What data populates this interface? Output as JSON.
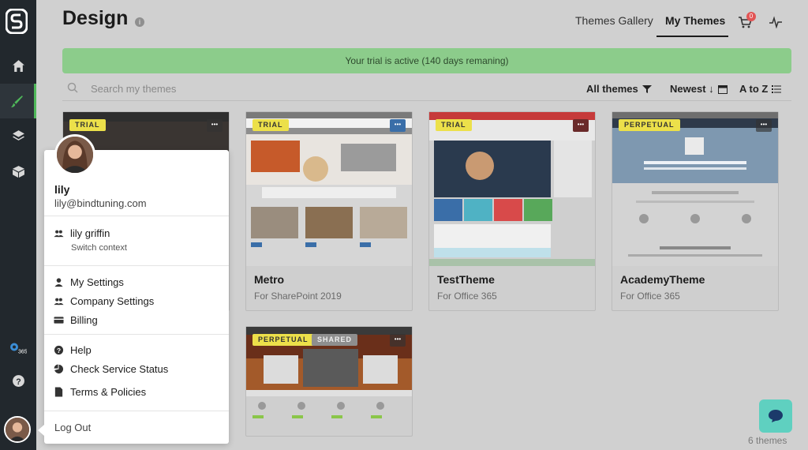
{
  "page": {
    "title": "Design",
    "info_glyph": "i"
  },
  "header": {
    "tabs": [
      {
        "label": "Themes Gallery",
        "active": false
      },
      {
        "label": "My Themes",
        "active": true
      }
    ],
    "cart_count": "0",
    "icons": [
      "cart-icon",
      "activity-icon"
    ]
  },
  "banner": {
    "text": "Your trial is active (140 days remaning)",
    "color": "#8ccc8b"
  },
  "search": {
    "placeholder": "Search my themes",
    "value": ""
  },
  "filters": {
    "all_themes": "All themes",
    "sort": "Newest ↓",
    "az": "A to Z"
  },
  "themes": [
    {
      "name": "",
      "subtitle": "",
      "badges": [
        "TRIAL"
      ]
    },
    {
      "name": "Metro",
      "subtitle": "For SharePoint 2019",
      "badges": [
        "TRIAL"
      ]
    },
    {
      "name": "TestTheme",
      "subtitle": "For Office 365",
      "badges": [
        "TRIAL"
      ]
    },
    {
      "name": "AcademyTheme",
      "subtitle": "For Office 365",
      "badges": [
        "PERPETUAL"
      ]
    },
    {
      "name": "",
      "subtitle": "",
      "badges": [
        "PERPETUAL",
        "SHARED"
      ]
    }
  ],
  "themes_count": "6 themes",
  "card_menu_glyph": "•••",
  "user_menu": {
    "name": "lily",
    "email": "lily@bindtuning.com",
    "context_name": "lily griffin",
    "context_sub": "Switch context",
    "my_settings": "My Settings",
    "company_settings": "Company Settings",
    "billing": "Billing",
    "help": "Help",
    "check_service_status": "Check Service Status",
    "terms": "Terms & Policies",
    "logout": "Log Out"
  },
  "sidebar": {
    "items": [
      "home-icon",
      "design-brush-icon",
      "layers-icon",
      "package-icon",
      "office365-settings-icon",
      "help-icon"
    ],
    "office365_label": "365",
    "help_glyph": "?",
    "accent": "#4fb85a"
  },
  "colors": {
    "rail_bg": "#22282d",
    "badge_yellow": "#ece04a",
    "chat": "#5fd0c0"
  }
}
